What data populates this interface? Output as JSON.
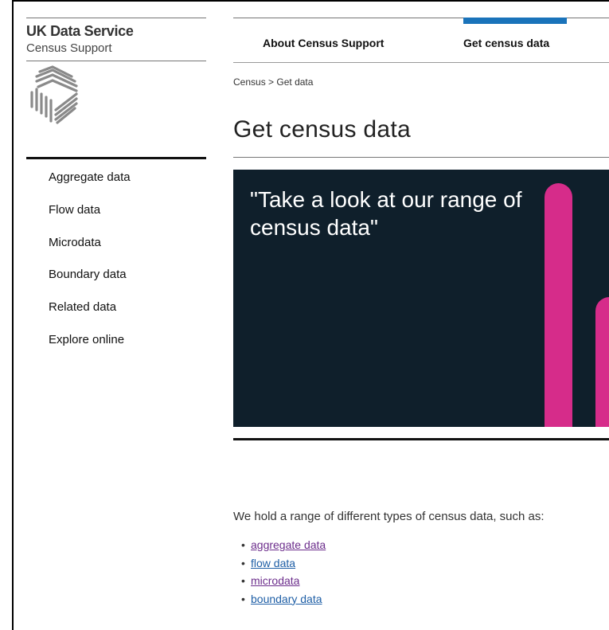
{
  "brand": {
    "name": "UK Data Service",
    "subtitle": "Census Support"
  },
  "sidebar": {
    "items": [
      {
        "label": "Aggregate data"
      },
      {
        "label": "Flow data"
      },
      {
        "label": "Microdata"
      },
      {
        "label": "Boundary data"
      },
      {
        "label": "Related data"
      },
      {
        "label": "Explore online"
      }
    ]
  },
  "topnav": {
    "items": [
      {
        "label": "About Census Support"
      },
      {
        "label": "Get census data",
        "active": true
      }
    ],
    "active_color": "#1a73ba"
  },
  "breadcrumb": {
    "home": "Census",
    "separator": ">",
    "current": "Get data"
  },
  "page": {
    "title": "Get census data"
  },
  "hero": {
    "quote": "\"Take a look at our range of census data\"",
    "background_color": "#0f1f2b",
    "accent_color": "#d62c8a"
  },
  "content": {
    "intro": "We hold a range of different types of census data, such as:",
    "links": [
      {
        "label": "aggregate data",
        "visited": true
      },
      {
        "label": "flow data",
        "visited": false
      },
      {
        "label": "microdata",
        "visited": true
      },
      {
        "label": "boundary data",
        "visited": false
      }
    ]
  }
}
